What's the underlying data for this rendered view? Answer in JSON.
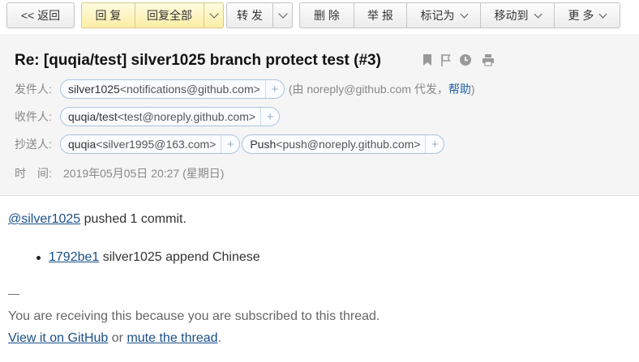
{
  "toolbar": {
    "back": "<< 返回",
    "reply": "回 复",
    "reply_all": "回复全部",
    "forward": "转 发",
    "delete": "删 除",
    "report": "举 报",
    "mark_as": "标记为",
    "move_to": "移动到",
    "more": "更 多"
  },
  "email": {
    "subject": "Re: [quqia/test] silver1025 branch protect test (#3)",
    "from_label": "发件人:",
    "from_name": "silver1025",
    "from_addr": "<notifications@github.com>",
    "proxy_prefix": "(由 noreply@github.com 代发，",
    "proxy_help": "帮助",
    "proxy_suffix": ")",
    "to_label": "收件人:",
    "to_name": "quqia/test",
    "to_addr": "<test@noreply.github.com>",
    "cc_label": "抄送人:",
    "cc1_name": "quqia",
    "cc1_addr": "<silver1995@163.com>",
    "cc2_name": "Push",
    "cc2_addr": "<push@noreply.github.com>",
    "time_label": "时　间:",
    "time_value": "2019年05月05日 20:27 (星期日)",
    "plus": "+"
  },
  "body": {
    "user_link": "@silver1025",
    "pushed_text": " pushed 1 commit.",
    "commit_hash": "1792be1",
    "commit_msg": " silver1025 append Chinese",
    "dash": "—",
    "receiving": "You are receiving this because you are subscribed to this thread.",
    "view_link": "View it on GitHub",
    "or_text": " or ",
    "mute_link": "mute the thread",
    "period": "."
  }
}
